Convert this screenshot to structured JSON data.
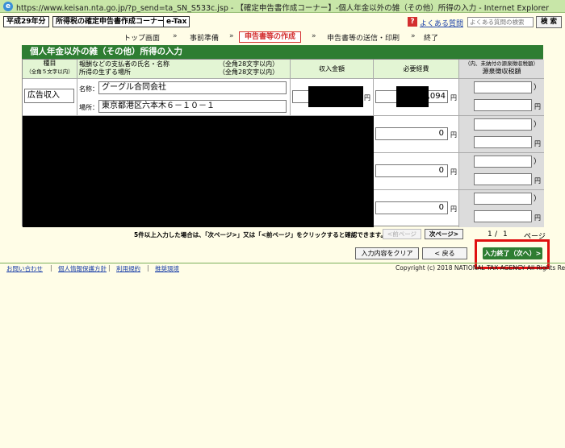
{
  "window": {
    "title": "https://www.keisan.nta.go.jp/?p_send=ta_SN_S533c.jsp - 【確定申告書作成コーナー】-個人年金以外の雑（その他）所得の入力 - Internet Explorer"
  },
  "header": {
    "year_label": "平成29年分",
    "corner_label": "所得税の確定申告書作成コーナー",
    "etax_label": "e-Tax",
    "faq_label": "よくある質問",
    "search_placeholder": "よくある質問の検索",
    "search_button": "検 索"
  },
  "steps": {
    "items": [
      "トップ画面",
      "事前準備",
      "申告書等の作成",
      "申告書等の送信・印刷",
      "終了"
    ],
    "arrow": "»",
    "current_index": 2
  },
  "section": {
    "title": "個人年金以外の雑（その他）所得の入力"
  },
  "table": {
    "headers": {
      "type": "種目",
      "type_sub": "（全角５文字以内）",
      "payer": "報酬などの支払者の氏名・名称",
      "payer_place": "所得の生ずる場所",
      "payer_limit1": "（全角28文字以内）",
      "payer_limit2": "（全角28文字以内）",
      "income": "収入金額",
      "expense": "必要経費",
      "withhold_sub": "（内、未納付の源泉徴収税額）",
      "withhold": "源泉徴収税額"
    },
    "row1": {
      "type_value": "広告収入",
      "name_label": "名称：",
      "name_value": "グーグル合同会社",
      "place_label": "場所：",
      "place_value": "東京都港区六本木６－１０－１",
      "income_value": "",
      "expense_value": ",094",
      "withhold_paren_open": "（",
      "withhold_paren_close": "）",
      "yen": "円"
    },
    "other_rows": {
      "expense_value": "0",
      "yen": "円",
      "paren_open": "（",
      "paren_close": "）"
    }
  },
  "pagination": {
    "note": "5件以上入力した場合は、「次ページ>」又は「<前ページ」をクリックすると確認できます。",
    "prev_label": "<前ページ",
    "next_label": "次ページ>",
    "current": "1",
    "separator": "/",
    "total": "1",
    "page_suffix": "ページ"
  },
  "actions": {
    "clear_label": "入力内容をクリア",
    "back_label": "< 戻る",
    "finish_label": "入力終了（次へ）>"
  },
  "footer": {
    "links": [
      "お問い合わせ",
      "個人情報保護方針",
      "利用規約",
      "推奨環境"
    ],
    "separator": "|",
    "copyright": "Copyright (c) 2018 NATIONAL TAX AGENCY All Rights Reserved."
  }
}
